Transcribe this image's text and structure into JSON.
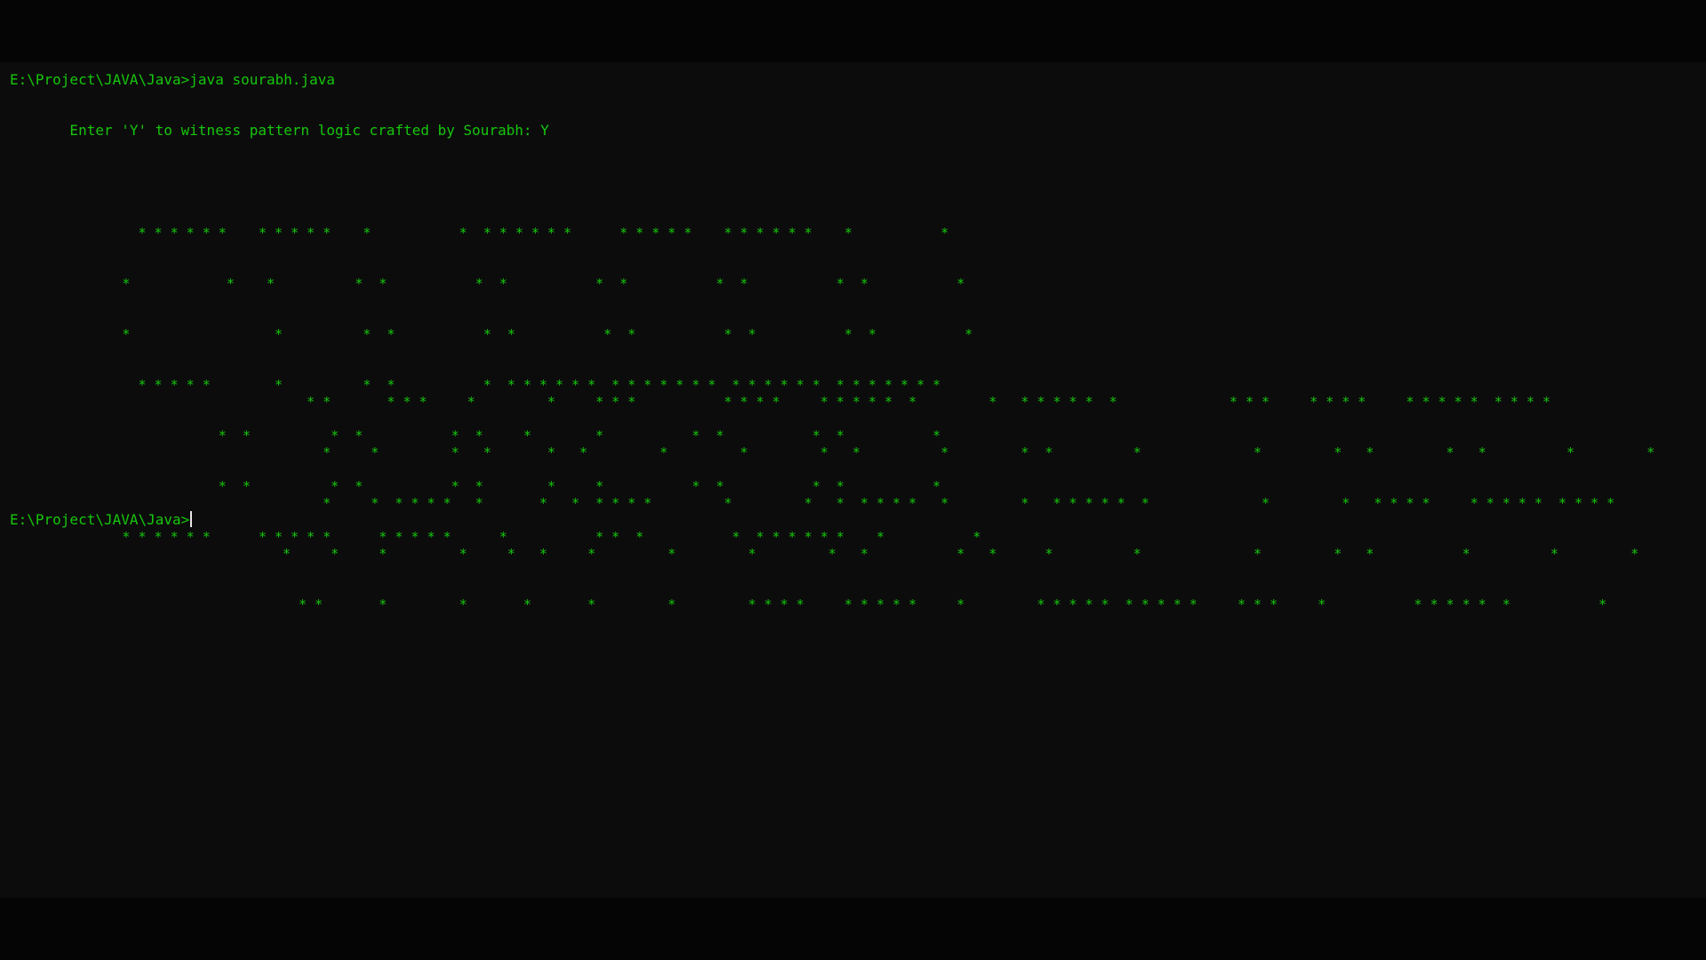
{
  "terminal": {
    "command_line": "E:\\Project\\JAVA\\Java>java sourabh.java",
    "prompt_message": "       Enter 'Y' to witness pattern logic crafted by Sourabh: Y",
    "final_prompt": "E:\\Project\\JAVA\\Java>",
    "banner_sourabh": [
      "                * * * * * *    * * * * *    *           *  * * * * * *      * * * * *    * * * * * *    *           *",
      "              *            *    *          *  *           *  *           *  *           *  *           *  *           *",
      "              *                  *          *  *           *  *           *  *           *  *           *  *           *",
      "                * * * * *        *          *  *           *  * * * * * *  * * * * * * *  * * * * * *  * * * * * * *",
      "                          *  *          *  *           *  *     *        *           *  *           *  *           *",
      "                          *  *          *  *           *  *        *     *           *  *           *  *           *",
      "              * * * * * *      * * * * *      * * * * *      *           * *  *           *  * * * * * *    *           *"
    ],
    "banner_java_developer": [
      "                                     * *       * * *     *         *     * * *           * * * *     * * * * *  *         *   * * * * *  *              * * *     * * * *     * * * * *  * * * *",
      "                                       *     *         *   *       *   *         *         *         *   *          *         *  *          *              *         *   *         *   *          *         *",
      "                                       *     *  * * * *   *       *   *  * * * *         *         *   *  * * * *   *         *   * * * * *  *              *         *   * * * *     * * * * *  * * * *",
      "                                  *     *     *         *     *   *     *         *         *         *   *           *   *      *          *              *         *   *           *          *         *",
      "                                    * *       *         *       *       *         *         * * * *     * * * * *     *         * * * * *  * * * * *     * * *     *           * * * * *  *           *"
    ]
  }
}
